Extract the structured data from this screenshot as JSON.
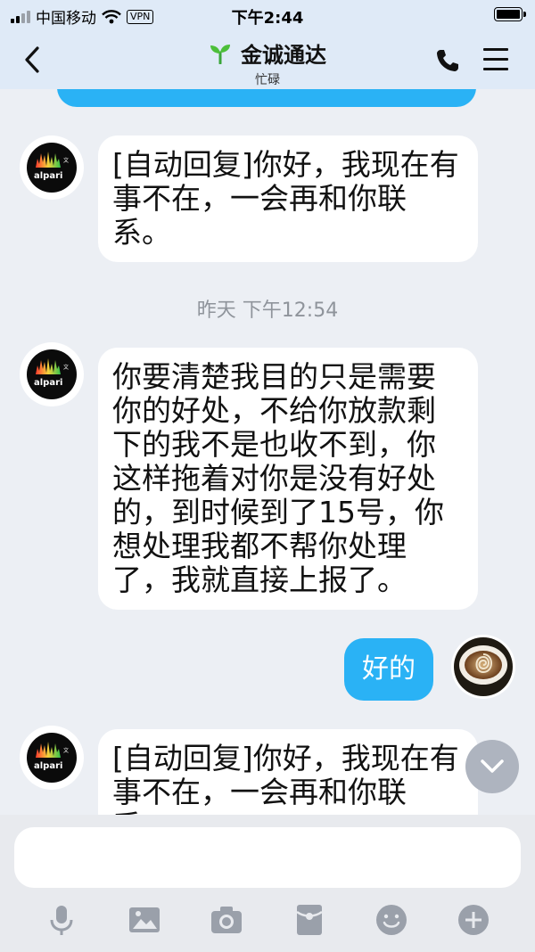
{
  "status_bar": {
    "carrier": "中国移动",
    "vpn": "VPN",
    "time": "下午2:44"
  },
  "header": {
    "contact_name": "金诚通达",
    "status": "忙碌"
  },
  "messages": [
    {
      "direction": "incoming",
      "avatar": "alpari-avatar",
      "text": "[自动回复]你好，我现在有事不在，一会再和你联系。"
    },
    {
      "type": "timestamp",
      "text": "昨天 下午12:54"
    },
    {
      "direction": "incoming",
      "avatar": "alpari-avatar",
      "text": "你要清楚我目的只是需要你的好处，不给你放款剩下的我不是也收不到，你这样拖着对你是没有好处的，到时候到了15号，你想处理我都不帮你处理了，我就直接上报了。"
    },
    {
      "direction": "outgoing",
      "avatar": "coffee-avatar",
      "text": "好的"
    },
    {
      "direction": "incoming",
      "avatar": "alpari-avatar",
      "text": "[自动回复]你好，我现在有事不在，一会再和你联系。"
    }
  ],
  "input": {
    "placeholder": "",
    "value": ""
  },
  "toolbar_icons": [
    "microphone-icon",
    "image-icon",
    "camera-icon",
    "red-packet-icon",
    "emoji-icon",
    "plus-icon"
  ],
  "colors": {
    "accent": "#2ab2f5",
    "header_bg": "#dfeaf7",
    "chat_bg": "#eceff4",
    "icon_gray": "#9aa0aa"
  }
}
